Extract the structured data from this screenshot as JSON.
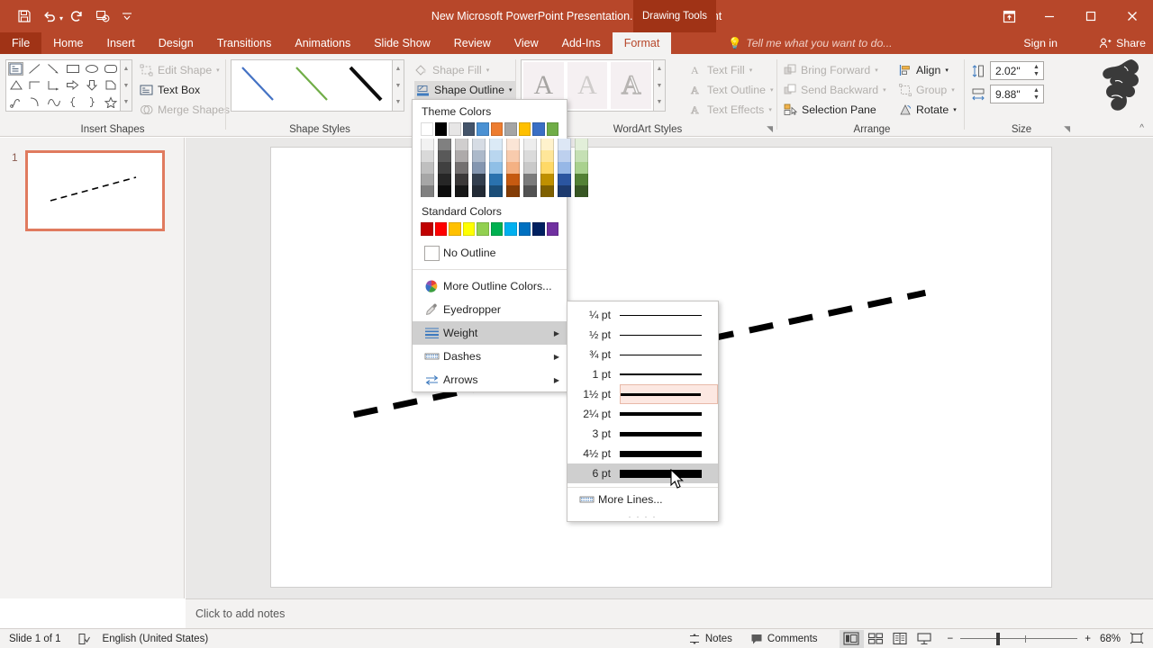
{
  "app": {
    "title": "New Microsoft PowerPoint Presentation.pptx - PowerPoint",
    "contextual_tab_label": "Drawing Tools",
    "accent_color": "#b7472a"
  },
  "quick_access": [
    {
      "name": "save-icon",
      "label": "Save"
    },
    {
      "name": "undo-icon",
      "label": "Undo"
    },
    {
      "name": "redo-icon",
      "label": "Redo"
    },
    {
      "name": "start-slideshow-icon",
      "label": "Start From Beginning"
    },
    {
      "name": "customize-qat-icon",
      "label": "Customize Quick Access Toolbar"
    }
  ],
  "window_buttons": [
    {
      "name": "ribbon-display-options-icon",
      "label": "Ribbon Display Options"
    },
    {
      "name": "minimize-icon",
      "label": "Minimize"
    },
    {
      "name": "restore-icon",
      "label": "Restore Down"
    },
    {
      "name": "close-icon",
      "label": "Close"
    }
  ],
  "tabs": [
    {
      "label": "File",
      "active": false,
      "file": true
    },
    {
      "label": "Home",
      "active": false
    },
    {
      "label": "Insert",
      "active": false
    },
    {
      "label": "Design",
      "active": false
    },
    {
      "label": "Transitions",
      "active": false
    },
    {
      "label": "Animations",
      "active": false
    },
    {
      "label": "Slide Show",
      "active": false
    },
    {
      "label": "Review",
      "active": false
    },
    {
      "label": "View",
      "active": false
    },
    {
      "label": "Add-Ins",
      "active": false
    },
    {
      "label": "Format",
      "active": true
    }
  ],
  "tell_me": {
    "placeholder": "Tell me what you want to do..."
  },
  "account": {
    "sign_in": "Sign in",
    "share": "Share"
  },
  "ribbon": {
    "groups": [
      {
        "name": "insert-shapes",
        "label": "Insert Shapes"
      },
      {
        "name": "shape-styles",
        "label": "Shape Styles"
      },
      {
        "name": "wordart-styles",
        "label": "WordArt Styles"
      },
      {
        "name": "arrange",
        "label": "Arrange"
      },
      {
        "name": "size",
        "label": "Size"
      }
    ],
    "insert_shapes": {
      "commands": [
        {
          "label": "Edit Shape",
          "disabled": true,
          "icon": "edit-shape-icon",
          "caret": true
        },
        {
          "label": "Text Box",
          "disabled": false,
          "icon": "text-box-icon",
          "caret": false
        },
        {
          "label": "Merge Shapes",
          "disabled": true,
          "icon": "merge-shapes-icon",
          "caret": true
        }
      ]
    },
    "shape_commands": [
      {
        "label": "Shape Fill",
        "disabled": true,
        "icon": "shape-fill-icon",
        "caret": true
      },
      {
        "label": "Shape Outline",
        "disabled": false,
        "icon": "shape-outline-icon",
        "caret": true,
        "open": true
      }
    ],
    "wordart_commands": [
      {
        "label": "Text Fill",
        "disabled": true,
        "icon": "text-fill-icon",
        "caret": true
      },
      {
        "label": "Text Outline",
        "disabled": true,
        "icon": "text-outline-icon",
        "caret": true
      },
      {
        "label": "Text Effects",
        "disabled": true,
        "icon": "text-effects-icon",
        "caret": true
      }
    ],
    "arrange_commands": [
      {
        "label": "Bring Forward",
        "disabled": true,
        "icon": "bring-forward-icon",
        "caret": true
      },
      {
        "label": "Send Backward",
        "disabled": true,
        "icon": "send-backward-icon",
        "caret": true
      },
      {
        "label": "Selection Pane",
        "disabled": false,
        "icon": "selection-pane-icon",
        "caret": false
      },
      {
        "label": "Align",
        "disabled": false,
        "icon": "align-icon",
        "caret": true
      },
      {
        "label": "Group",
        "disabled": true,
        "icon": "group-icon",
        "caret": true
      },
      {
        "label": "Rotate",
        "disabled": false,
        "icon": "rotate-icon",
        "caret": true
      }
    ],
    "size": {
      "height": {
        "label": "Shape Height",
        "value": "2.02\""
      },
      "width": {
        "label": "Shape Width",
        "value": "9.88\""
      }
    },
    "collapse_label": "Collapse the Ribbon"
  },
  "outline_menu": {
    "theme_colors_header": "Theme Colors",
    "standard_colors_header": "Standard Colors",
    "theme_base": [
      "#ffffff",
      "#000000",
      "#e7e6e6",
      "#44546a",
      "#4a91d3",
      "#ed7d31",
      "#a5a5a5",
      "#ffc000",
      "#3a6fc4",
      "#70ad47"
    ],
    "theme_variants": [
      [
        "#f2f2f2",
        "#808080",
        "#d0cece",
        "#d6dce4",
        "#dbeaf6",
        "#fbe5d6",
        "#ededed",
        "#fff2cc",
        "#dde7f5",
        "#e2efd9"
      ],
      [
        "#d9d9d9",
        "#595959",
        "#aeaaaa",
        "#acb9ca",
        "#b9d6ef",
        "#f8cbad",
        "#dbdbdb",
        "#ffe699",
        "#bdd0ee",
        "#c5e0b4"
      ],
      [
        "#bfbfbf",
        "#404040",
        "#747070",
        "#8496b0",
        "#8fbfe6",
        "#f4b183",
        "#c9c9c9",
        "#ffd966",
        "#96b7e6",
        "#a9d18e"
      ],
      [
        "#a6a6a6",
        "#262626",
        "#3b3838",
        "#333f4f",
        "#2a72ae",
        "#c55a11",
        "#7b7b7b",
        "#bf9000",
        "#2b55a0",
        "#538135"
      ],
      [
        "#808080",
        "#0d0d0d",
        "#161616",
        "#222a35",
        "#1b4e78",
        "#833c06",
        "#525252",
        "#7f6000",
        "#1d3a6e",
        "#375623"
      ]
    ],
    "standard_colors": [
      "#c00000",
      "#ff0000",
      "#ffc000",
      "#ffff00",
      "#92d050",
      "#00b050",
      "#00b0f0",
      "#0070c0",
      "#002060",
      "#7030a0"
    ],
    "items": [
      {
        "label": "No Outline",
        "icon": "no-outline-swatch-icon",
        "submenu": false,
        "highlighted": false
      },
      {
        "label": "More Outline Colors...",
        "icon": "color-wheel-icon",
        "submenu": false,
        "highlighted": false
      },
      {
        "label": "Eyedropper",
        "icon": "eyedropper-icon",
        "submenu": false,
        "highlighted": false
      },
      {
        "label": "Weight",
        "icon": "weight-icon",
        "submenu": true,
        "highlighted": true
      },
      {
        "label": "Dashes",
        "icon": "dashes-icon",
        "submenu": true,
        "highlighted": false
      },
      {
        "label": "Arrows",
        "icon": "arrows-icon",
        "submenu": true,
        "highlighted": false
      }
    ]
  },
  "weight_submenu": {
    "items": [
      {
        "label": "¼ pt",
        "thickness": 1,
        "selected": false,
        "highlighted": false
      },
      {
        "label": "½ pt",
        "thickness": 1,
        "selected": false,
        "highlighted": false
      },
      {
        "label": "¾ pt",
        "thickness": 1,
        "selected": false,
        "highlighted": false
      },
      {
        "label": "1 pt",
        "thickness": 2,
        "selected": false,
        "highlighted": false
      },
      {
        "label": "1½ pt",
        "thickness": 3,
        "selected": true,
        "highlighted": false
      },
      {
        "label": "2¼ pt",
        "thickness": 4,
        "selected": false,
        "highlighted": false
      },
      {
        "label": "3 pt",
        "thickness": 5,
        "selected": false,
        "highlighted": false
      },
      {
        "label": "4½ pt",
        "thickness": 7,
        "selected": false,
        "highlighted": false
      },
      {
        "label": "6 pt",
        "thickness": 9,
        "selected": false,
        "highlighted": true
      }
    ],
    "more_lines": {
      "label": "More Lines...",
      "icon": "more-lines-icon"
    }
  },
  "slide_panel": {
    "slides": [
      {
        "number": "1",
        "selected": true
      }
    ]
  },
  "notes": {
    "placeholder": "Click to add notes"
  },
  "status_bar": {
    "slide_count": "Slide 1 of 1",
    "spellcheck_icon": "spellcheck-icon",
    "language": "English (United States)",
    "notes_label": "Notes",
    "comments_label": "Comments",
    "views": [
      {
        "name": "normal-view-icon",
        "label": "Normal",
        "active": true
      },
      {
        "name": "slide-sorter-icon",
        "label": "Slide Sorter",
        "active": false
      },
      {
        "name": "reading-view-icon",
        "label": "Reading View",
        "active": false
      },
      {
        "name": "slideshow-view-icon",
        "label": "Slide Show",
        "active": false
      }
    ],
    "zoom_out": "−",
    "zoom_in": "+",
    "zoom_level": "68%",
    "fit_slide_icon": "fit-slide-to-window-icon"
  }
}
